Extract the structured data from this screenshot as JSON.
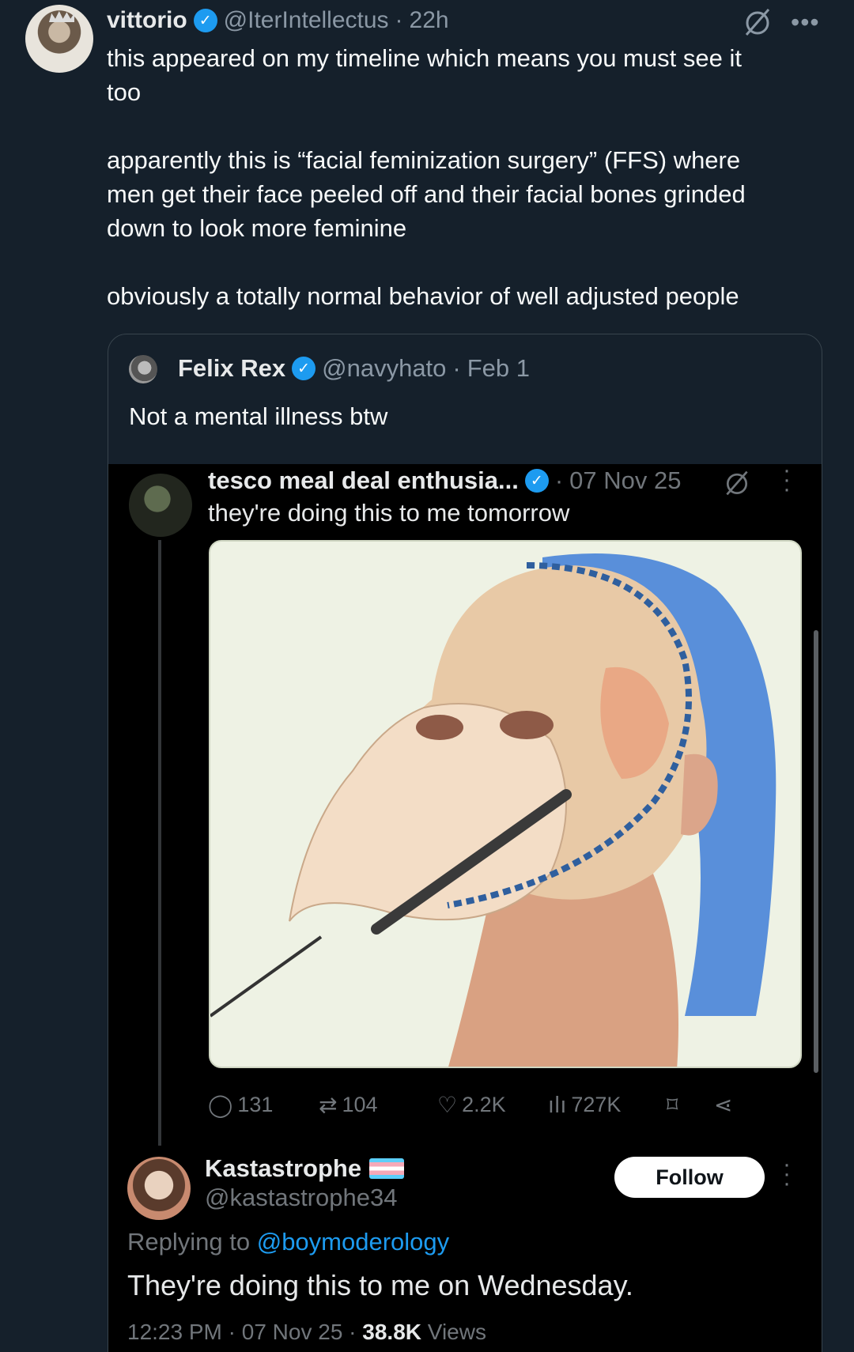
{
  "post": {
    "author_name": "vittorio",
    "author_handle": "@IterIntellectus",
    "time": "22h",
    "text": "this appeared on my timeline which means you must see it\ntoo\n\napparently this is “facial feminization surgery” (FFS) where\nmen get their face peeled off and their facial bones grinded\ndown to look more feminine\n\nobviously a totally normal behavior of well adjusted people",
    "more_icon": "•••"
  },
  "quote": {
    "author_name": "Felix Rex",
    "author_handle": "@navyhato",
    "date": "Feb 1",
    "text": "Not a mental illness btw",
    "embedded": {
      "author_name": "tesco meal deal enthusia...",
      "date": "07 Nov 25",
      "text": "they're doing this to me tomorrow",
      "image_subject": "surgical illustration of facial surgery",
      "stats": {
        "replies": "131",
        "reposts": "104",
        "likes": "2.2K",
        "views": "727K"
      },
      "reply": {
        "author_name": "Kastastrophe",
        "author_handle": "@kastastrophe34",
        "follow_label": "Follow",
        "replying_prefix": "Replying to",
        "replying_to": "@boymoderology",
        "text": "They're doing this to me on Wednesday.",
        "time": "12:23 PM",
        "date": "07 Nov 25",
        "views_count": "38.8K",
        "views_label": "Views"
      }
    }
  },
  "colors": {
    "background": "#15202b",
    "verified": "#1d9bf0",
    "link": "#1d9bf0",
    "muted": "#8b98a5"
  }
}
